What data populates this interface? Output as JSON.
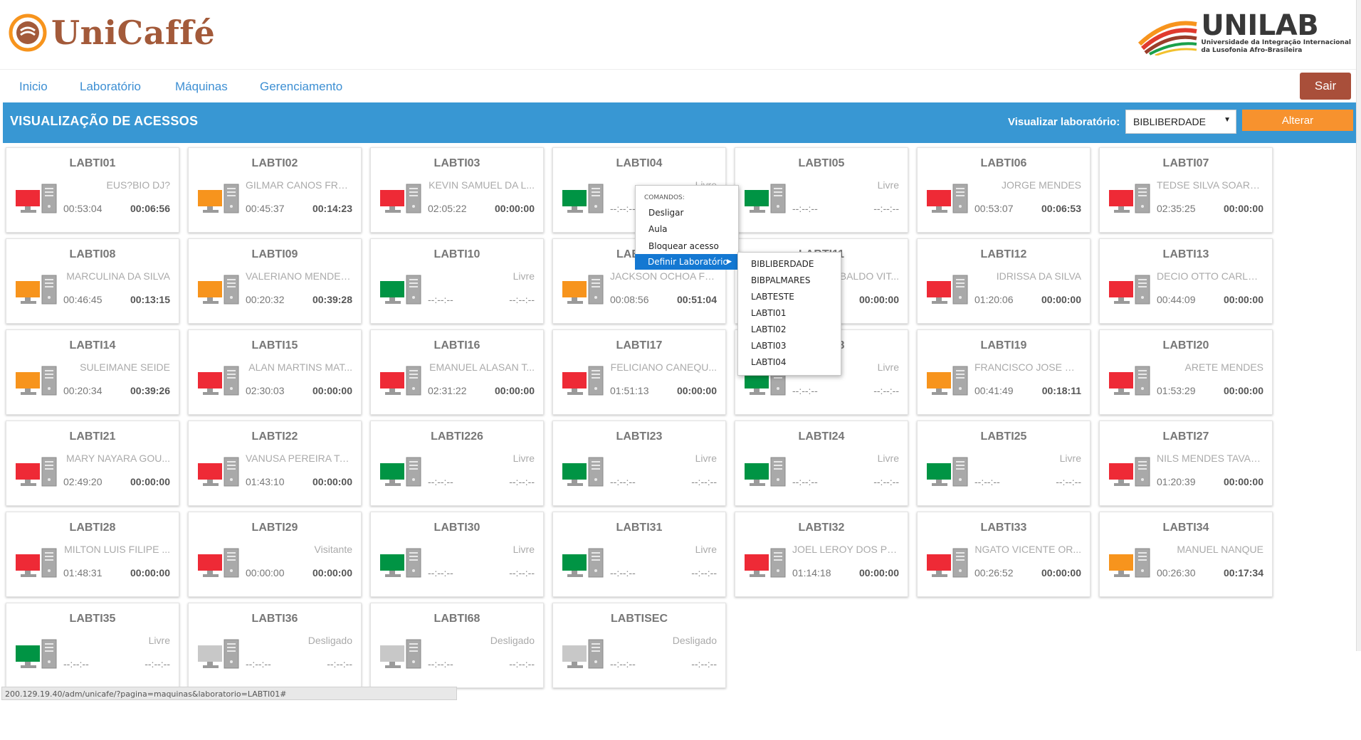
{
  "header": {
    "brand": "UniCaffé",
    "university_name": "UNILAB",
    "university_sub_1": "Universidade da Integração Internacional",
    "university_sub_2": "da Lusofonia Afro-Brasileira"
  },
  "nav": {
    "items": [
      "Inicio",
      "Laboratório",
      "Máquinas",
      "Gerenciamento"
    ],
    "logout": "Sair"
  },
  "toolbar": {
    "title": "VISUALIZAÇÃO DE ACESSOS",
    "lab_label": "Visualizar laboratório:",
    "lab_selected": "BIBLIBERDADE",
    "alter_button": "Alterar"
  },
  "status_colors": {
    "red": "#ee2a36",
    "orange": "#f7941d",
    "green": "#009444",
    "gray": "#c8c8c8",
    "accent_blue": "#3897d3",
    "alter_orange": "#f7922e",
    "logout_brown": "#a94f3a"
  },
  "machines": [
    {
      "name": "LABTI01",
      "user": "EUS?BIO DJ?",
      "time_in": "00:53:04",
      "time_left": "00:06:56",
      "status": "red"
    },
    {
      "name": "LABTI02",
      "user": "GILMAR CANOS FROSE",
      "time_in": "00:45:37",
      "time_left": "00:14:23",
      "status": "orange"
    },
    {
      "name": "LABTI03",
      "user": "KEVIN SAMUEL DA L...",
      "time_in": "02:05:22",
      "time_left": "00:00:00",
      "status": "red"
    },
    {
      "name": "LABTI04",
      "user": "Livre",
      "time_in": "--:--:--",
      "time_left": "--:--:--",
      "status": "green"
    },
    {
      "name": "LABTI05",
      "user": "Livre",
      "time_in": "--:--:--",
      "time_left": "--:--:--",
      "status": "green"
    },
    {
      "name": "LABTI06",
      "user": "JORGE MENDES",
      "time_in": "00:53:07",
      "time_left": "00:06:53",
      "status": "red"
    },
    {
      "name": "LABTI07",
      "user": "TEDSE SILVA SOARES...",
      "time_in": "02:35:25",
      "time_left": "00:00:00",
      "status": "red"
    },
    {
      "name": "LABTI08",
      "user": "MARCULINA DA SILVA",
      "time_in": "00:46:45",
      "time_left": "00:13:15",
      "status": "orange"
    },
    {
      "name": "LABTI09",
      "user": "VALERIANO MENDES...",
      "time_in": "00:20:32",
      "time_left": "00:39:28",
      "status": "orange"
    },
    {
      "name": "LABTI10",
      "user": "Livre",
      "time_in": "--:--:--",
      "time_left": "--:--:--",
      "status": "green"
    },
    {
      "name": "LABTI11",
      "user": "JACKSON OCHOA FO...",
      "time_in": "00:08:56",
      "time_left": "00:51:04",
      "status": "orange"
    },
    {
      "name": "LABTI11",
      "user": "...BALDO VIT...",
      "time_in": "",
      "time_left": "00:00:00",
      "status": "red"
    },
    {
      "name": "LABTI12",
      "user": "IDRISSA DA SILVA",
      "time_in": "01:20:06",
      "time_left": "00:00:00",
      "status": "red"
    },
    {
      "name": "LABTI13",
      "user": "DECIO OTTO CARLO...",
      "time_in": "00:44:09",
      "time_left": "00:00:00",
      "status": "red"
    },
    {
      "name": "LABTI14",
      "user": "SULEIMANE SEIDE",
      "time_in": "00:20:34",
      "time_left": "00:39:26",
      "status": "orange"
    },
    {
      "name": "LABTI15",
      "user": "ALAN MARTINS MAT...",
      "time_in": "02:30:03",
      "time_left": "00:00:00",
      "status": "red"
    },
    {
      "name": "LABTI16",
      "user": "EMANUEL ALASAN T...",
      "time_in": "02:31:22",
      "time_left": "00:00:00",
      "status": "red"
    },
    {
      "name": "LABTI17",
      "user": "FELICIANO CANEQU...",
      "time_in": "01:51:13",
      "time_left": "00:00:00",
      "status": "red"
    },
    {
      "name": "LABTI18",
      "user": "Livre",
      "time_in": "--:--:--",
      "time_left": "--:--:--",
      "status": "green"
    },
    {
      "name": "LABTI19",
      "user": "FRANCISCO JOSE DA ...",
      "time_in": "00:41:49",
      "time_left": "00:18:11",
      "status": "orange"
    },
    {
      "name": "LABTI20",
      "user": "ARETE MENDES",
      "time_in": "01:53:29",
      "time_left": "00:00:00",
      "status": "red"
    },
    {
      "name": "LABTI21",
      "user": "MARY NAYARA GOU...",
      "time_in": "02:49:20",
      "time_left": "00:00:00",
      "status": "red"
    },
    {
      "name": "LABTI22",
      "user": "VANUSA PEREIRA TA...",
      "time_in": "01:43:10",
      "time_left": "00:00:00",
      "status": "red"
    },
    {
      "name": "LABTI226",
      "user": "Livre",
      "time_in": "--:--:--",
      "time_left": "--:--:--",
      "status": "green"
    },
    {
      "name": "LABTI23",
      "user": "Livre",
      "time_in": "--:--:--",
      "time_left": "--:--:--",
      "status": "green"
    },
    {
      "name": "LABTI24",
      "user": "Livre",
      "time_in": "--:--:--",
      "time_left": "--:--:--",
      "status": "green"
    },
    {
      "name": "LABTI25",
      "user": "Livre",
      "time_in": "--:--:--",
      "time_left": "--:--:--",
      "status": "green"
    },
    {
      "name": "LABTI27",
      "user": "NILS MENDES TAVAR...",
      "time_in": "01:20:39",
      "time_left": "00:00:00",
      "status": "red"
    },
    {
      "name": "LABTI28",
      "user": "MILTON LUIS FILIPE ...",
      "time_in": "01:48:31",
      "time_left": "00:00:00",
      "status": "red"
    },
    {
      "name": "LABTI29",
      "user": "Visitante",
      "time_in": "00:00:00",
      "time_left": "00:00:00",
      "status": "red"
    },
    {
      "name": "LABTI30",
      "user": "Livre",
      "time_in": "--:--:--",
      "time_left": "--:--:--",
      "status": "green"
    },
    {
      "name": "LABTI31",
      "user": "Livre",
      "time_in": "--:--:--",
      "time_left": "--:--:--",
      "status": "green"
    },
    {
      "name": "LABTI32",
      "user": "JOEL LEROY DOS PR...",
      "time_in": "01:14:18",
      "time_left": "00:00:00",
      "status": "red"
    },
    {
      "name": "LABTI33",
      "user": "NGATO VICENTE OR...",
      "time_in": "00:26:52",
      "time_left": "00:00:00",
      "status": "red"
    },
    {
      "name": "LABTI34",
      "user": "MANUEL NANQUE",
      "time_in": "00:26:30",
      "time_left": "00:17:34",
      "status": "orange"
    },
    {
      "name": "LABTI35",
      "user": "Livre",
      "time_in": "--:--:--",
      "time_left": "--:--:--",
      "status": "green"
    },
    {
      "name": "LABTI36",
      "user": "Desligado",
      "time_in": "--:--:--",
      "time_left": "--:--:--",
      "status": "gray"
    },
    {
      "name": "LABTI68",
      "user": "Desligado",
      "time_in": "--:--:--",
      "time_left": "--:--:--",
      "status": "gray"
    },
    {
      "name": "LABTISEC",
      "user": "Desligado",
      "time_in": "--:--:--",
      "time_left": "--:--:--",
      "status": "gray"
    }
  ],
  "context_menu": {
    "header": "COMANDOS:",
    "items": [
      "Desligar",
      "Aula",
      "Bloquear acesso",
      "Definir Laboratório"
    ],
    "submenu": [
      "BIBLIBERDADE",
      "BIBPALMARES",
      "LABTESTE",
      "LABTI01",
      "LABTI02",
      "LABTI03",
      "LABTI04"
    ]
  },
  "status_bar": {
    "url": "200.129.19.40/adm/unicafe/?pagina=maquinas&laboratorio=LABTI01#"
  }
}
